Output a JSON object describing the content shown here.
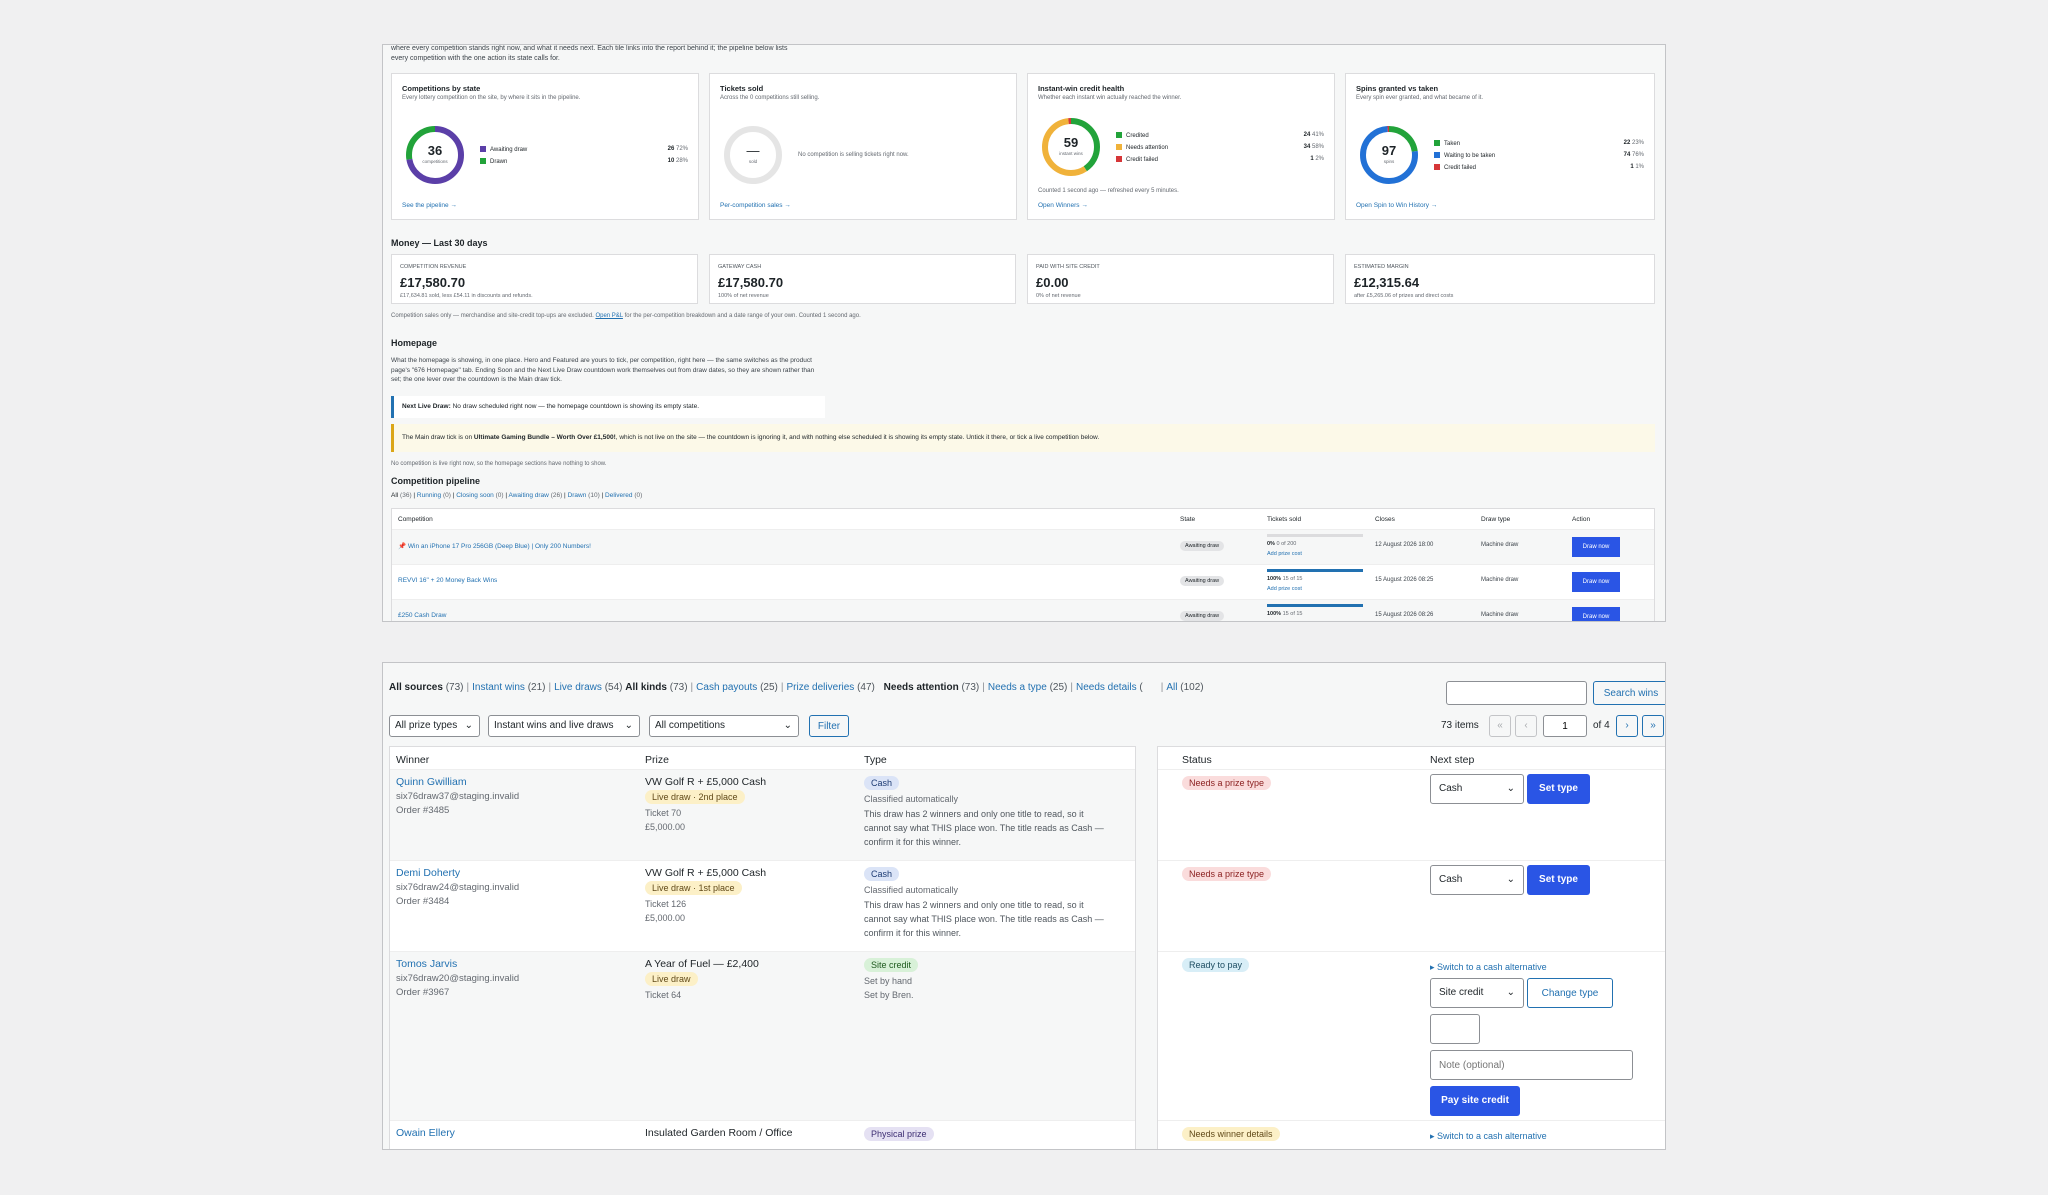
{
  "win1": {
    "intro": "where every competition stands right now, and what it needs next. Each tile links into the report behind it; the pipeline below lists every competition with the one action its state calls for.",
    "cards": {
      "competitions": {
        "title": "Competitions by state",
        "subtitle": "Every lottery competition on the site, by where it sits in the pipeline.",
        "center_value": "36",
        "center_label": "competitions",
        "legend": [
          {
            "label": "Awaiting draw",
            "count": "26",
            "pct": "72%",
            "color": "#5b3fa8",
            "value": 26
          },
          {
            "label": "Drawn",
            "count": "10",
            "pct": "28%",
            "color": "#22a33a",
            "value": 10
          }
        ],
        "link": "See the pipeline →"
      },
      "tickets": {
        "title": "Tickets sold",
        "subtitle": "Across the 0 competitions still selling.",
        "center_value": "—",
        "center_label": "sold",
        "empty_text": "No competition is selling tickets right now.",
        "link": "Per-competition sales →"
      },
      "instant": {
        "title": "Instant-win credit health",
        "subtitle": "Whether each instant win actually reached the winner.",
        "center_value": "59",
        "center_label": "instant wins",
        "legend": [
          {
            "label": "Credited",
            "count": "24",
            "pct": "41%",
            "color": "#22a33a",
            "value": 24
          },
          {
            "label": "Needs attention",
            "count": "34",
            "pct": "58%",
            "color": "#f0b23a",
            "value": 34
          },
          {
            "label": "Credit failed",
            "count": "1",
            "pct": "2%",
            "color": "#d63638",
            "value": 1
          }
        ],
        "note": "Counted 1 second ago — refreshed every 5 minutes.",
        "link": "Open Winners →"
      },
      "spins": {
        "title": "Spins granted vs taken",
        "subtitle": "Every spin ever granted, and what became of it.",
        "center_value": "97",
        "center_label": "spins",
        "legend": [
          {
            "label": "Taken",
            "count": "22",
            "pct": "23%",
            "color": "#22a33a",
            "value": 22
          },
          {
            "label": "Waiting to be taken",
            "count": "74",
            "pct": "76%",
            "color": "#2271d6",
            "value": 74
          },
          {
            "label": "Credit failed",
            "count": "1",
            "pct": "1%",
            "color": "#d63638",
            "value": 1
          }
        ],
        "link": "Open Spin to Win History →"
      }
    },
    "money": {
      "heading": "Money — Last 30 days",
      "cards": [
        {
          "label": "Competition revenue",
          "value": "£17,580.70",
          "sub": "£17,634.81 sold, less £54.11 in discounts and refunds."
        },
        {
          "label": "Gateway cash",
          "value": "£17,580.70",
          "sub": "100% of net revenue"
        },
        {
          "label": "Paid with site credit",
          "value": "£0.00",
          "sub": "0% of net revenue"
        },
        {
          "label": "Estimated margin",
          "value": "£12,315.64",
          "sub": "after £5,265.06 of prizes and direct costs"
        }
      ],
      "footnote_a": "Competition sales only — merchandise and site-credit top-ups are excluded.",
      "footnote_link": "Open P&L",
      "footnote_b": "for the per-competition breakdown and a date range of your own. Counted 1 second ago."
    },
    "homepage": {
      "heading": "Homepage",
      "para": "What the homepage is showing, in one place. Hero and Featured are yours to tick, per competition, right here — the same switches as the product page's \"676 Homepage\" tab. Ending Soon and the Next Live Draw countdown work themselves out from draw dates, so they are shown rather than set; the one lever over the countdown is the Main draw tick.",
      "notice_label": "Next Live Draw:",
      "notice_text": "No draw scheduled right now — the homepage countdown is showing its empty state.",
      "warn_a": "The Main draw tick is on",
      "warn_bold": "Ultimate Gaming Bundle – Worth Over £1,500!",
      "warn_b": ", which is not live on the site — the countdown is ignoring it, and with nothing else scheduled it is showing its empty state. Untick it there, or tick a live competition below.",
      "empty_note": "No competition is live right now, so the homepage sections have nothing to show."
    },
    "pipeline": {
      "heading": "Competition pipeline",
      "tabs": [
        {
          "label": "All",
          "count": "(36)",
          "active": true
        },
        {
          "label": "Running",
          "count": "(0)"
        },
        {
          "label": "Closing soon",
          "count": "(0)"
        },
        {
          "label": "Awaiting draw",
          "count": "(26)"
        },
        {
          "label": "Drawn",
          "count": "(10)"
        },
        {
          "label": "Delivered",
          "count": "(0)"
        }
      ],
      "headers": {
        "competition": "Competition",
        "state": "State",
        "tickets": "Tickets sold",
        "closes": "Closes",
        "draw_type": "Draw type",
        "action": "Action"
      },
      "rows": [
        {
          "name": "Win an iPhone 17 Pro 256GB (Deep Blue) | Only 200 Numbers!",
          "pin": "📌",
          "state": "Awaiting draw",
          "pct": "0%",
          "of": "0 of 200",
          "fill": 0,
          "cost": "Add prize cost",
          "closes": "12 August 2026 18:00",
          "type": "Machine draw",
          "action": "Draw now"
        },
        {
          "name": "REVVI 16\" + 20 Money Back Wins",
          "pin": "",
          "state": "Awaiting draw",
          "pct": "100%",
          "of": "15 of 15",
          "fill": 100,
          "cost": "Add prize cost",
          "closes": "15 August 2026 08:25",
          "type": "Machine draw",
          "action": "Draw now"
        },
        {
          "name": "£250 Cash Draw",
          "pin": "",
          "state": "Awaiting draw",
          "pct": "100%",
          "of": "15 of 15",
          "fill": 100,
          "cost": "",
          "closes": "15 August 2026 08:26",
          "type": "Machine draw",
          "action": "Draw now"
        }
      ]
    }
  },
  "win2": {
    "sources": [
      {
        "label": "All sources",
        "count": "(73)",
        "active": true
      },
      {
        "label": "Instant wins",
        "count": "(21)"
      },
      {
        "label": "Live draws",
        "count": "(54)"
      }
    ],
    "kinds": [
      {
        "label": "All kinds",
        "count": "(73)",
        "active": true
      },
      {
        "label": "Cash payouts",
        "count": "(25)"
      },
      {
        "label": "Prize deliveries",
        "count": "(47)"
      }
    ],
    "attention": [
      {
        "label": "Needs attention",
        "count": "(73)",
        "active": true
      },
      {
        "label": "Needs a type",
        "count": "(25)"
      },
      {
        "label": "Needs details",
        "count": "("
      },
      {
        "label": "All",
        "count": "(102)"
      }
    ],
    "search_button": "Search wins",
    "filters": {
      "prize_types": "All prize types",
      "sources": "Instant wins and live draws",
      "competitions": "All competitions",
      "button": "Filter"
    },
    "pagination": {
      "items": "73 items",
      "first": "«",
      "prev": "‹",
      "page": "1",
      "of": "of 4",
      "next": "›",
      "last": "»"
    },
    "headers": {
      "winner": "Winner",
      "prize": "Prize",
      "type": "Type",
      "status": "Status",
      "next_step": "Next step"
    },
    "rows": [
      {
        "name": "Quinn Gwilliam",
        "email": "six76draw37@staging.invalid",
        "order": "Order #3485",
        "prize": "VW Golf R + £5,000 Cash",
        "tag": "Live draw · 2nd place",
        "ticket": "Ticket 70",
        "amount": "£5,000.00",
        "type": "Cash",
        "type_note": "Classified automatically",
        "desc": "This draw has 2 winners and only one title to read, so it cannot say what THIS place won. The title reads as Cash — confirm it for this winner.",
        "status": "Needs a prize type",
        "select": "Cash",
        "button": "Set type"
      },
      {
        "name": "Demi Doherty",
        "email": "six76draw24@staging.invalid",
        "order": "Order #3484",
        "prize": "VW Golf R + £5,000 Cash",
        "tag": "Live draw · 1st place",
        "ticket": "Ticket 126",
        "amount": "£5,000.00",
        "type": "Cash",
        "type_note": "Classified automatically",
        "desc": "This draw has 2 winners and only one title to read, so it cannot say what THIS place won. The title reads as Cash — confirm it for this winner.",
        "status": "Needs a prize type",
        "select": "Cash",
        "button": "Set type"
      },
      {
        "name": "Tomos Jarvis",
        "email": "six76draw20@staging.invalid",
        "order": "Order #3967",
        "prize": "A Year of Fuel — £2,400",
        "tag": "Live draw",
        "ticket": "Ticket 64",
        "type": "Site credit",
        "type_note": "Set by hand",
        "type_note2": "Set by Bren.",
        "status": "Ready to pay",
        "switch": "▸ Switch to a cash alternative",
        "select": "Site credit",
        "button": "Change type",
        "note_placeholder": "Note (optional)",
        "pay_button": "Pay site credit"
      },
      {
        "name": "Owain Ellery",
        "prize": "Insulated Garden Room / Office",
        "type": "Physical prize",
        "status": "Needs winner details",
        "switch": "▸ Switch to a cash alternative"
      }
    ]
  }
}
